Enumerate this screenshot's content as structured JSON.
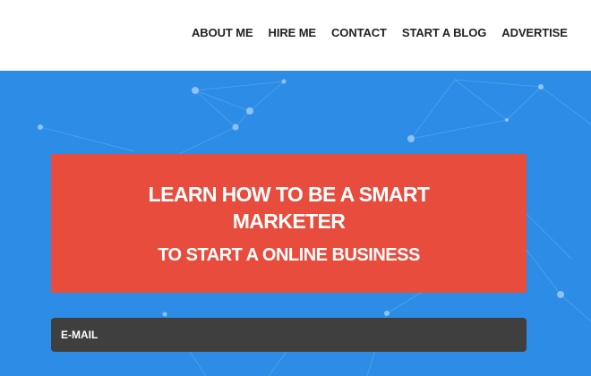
{
  "nav": {
    "items": [
      {
        "label": "ABOUT ME"
      },
      {
        "label": "HIRE ME"
      },
      {
        "label": "CONTACT"
      },
      {
        "label": "START A BLOG"
      },
      {
        "label": "ADVERTISE"
      }
    ]
  },
  "hero": {
    "headline_line1": "LEARN HOW TO BE A SMART",
    "headline_line2": "MARKETER",
    "subheadline": "TO START A ONLINE BUSINESS",
    "email_placeholder": "E-MAIL"
  },
  "colors": {
    "hero_background": "#2d8de6",
    "headline_box": "#e84c3d",
    "email_field": "#3f3f3f",
    "nav_text": "#222222"
  }
}
